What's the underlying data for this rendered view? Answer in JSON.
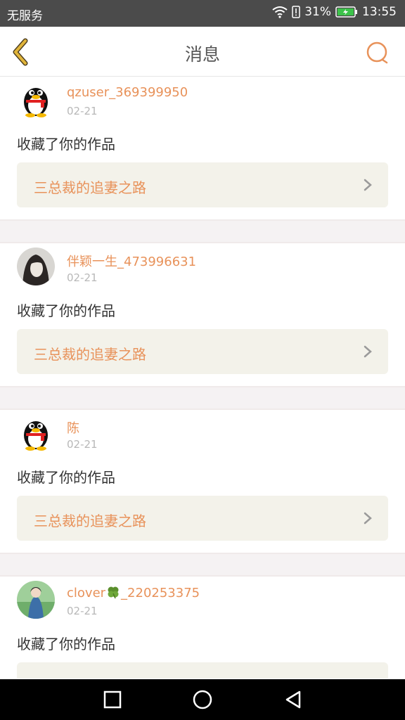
{
  "status_bar": {
    "carrier": "无服务",
    "battery_percent": "31%",
    "time": "13:55"
  },
  "header": {
    "title": "消息"
  },
  "messages": [
    {
      "username": "qzuser_369399950",
      "date": "02-21",
      "action": "收藏了你的作品",
      "work_title": "三总裁的追妻之路",
      "avatar": "penguin-avatar"
    },
    {
      "username": "伴颖一生_473996631",
      "date": "02-21",
      "action": "收藏了你的作品",
      "work_title": "三总裁的追妻之路",
      "avatar": "photo-avatar"
    },
    {
      "username": "陈",
      "date": "02-21",
      "action": "收藏了你的作品",
      "work_title": "三总裁的追妻之路",
      "avatar": "penguin-avatar"
    },
    {
      "username_prefix": "clover",
      "username_suffix": "_220253375",
      "date": "02-21",
      "action": "收藏了你的作品",
      "work_title": "",
      "avatar": "photo-avatar"
    }
  ],
  "colors": {
    "accent": "#e8925a",
    "back_arrow": "#e0b43a",
    "status_bar": "#4b4b4b",
    "card_bg": "#f3f2ea"
  }
}
